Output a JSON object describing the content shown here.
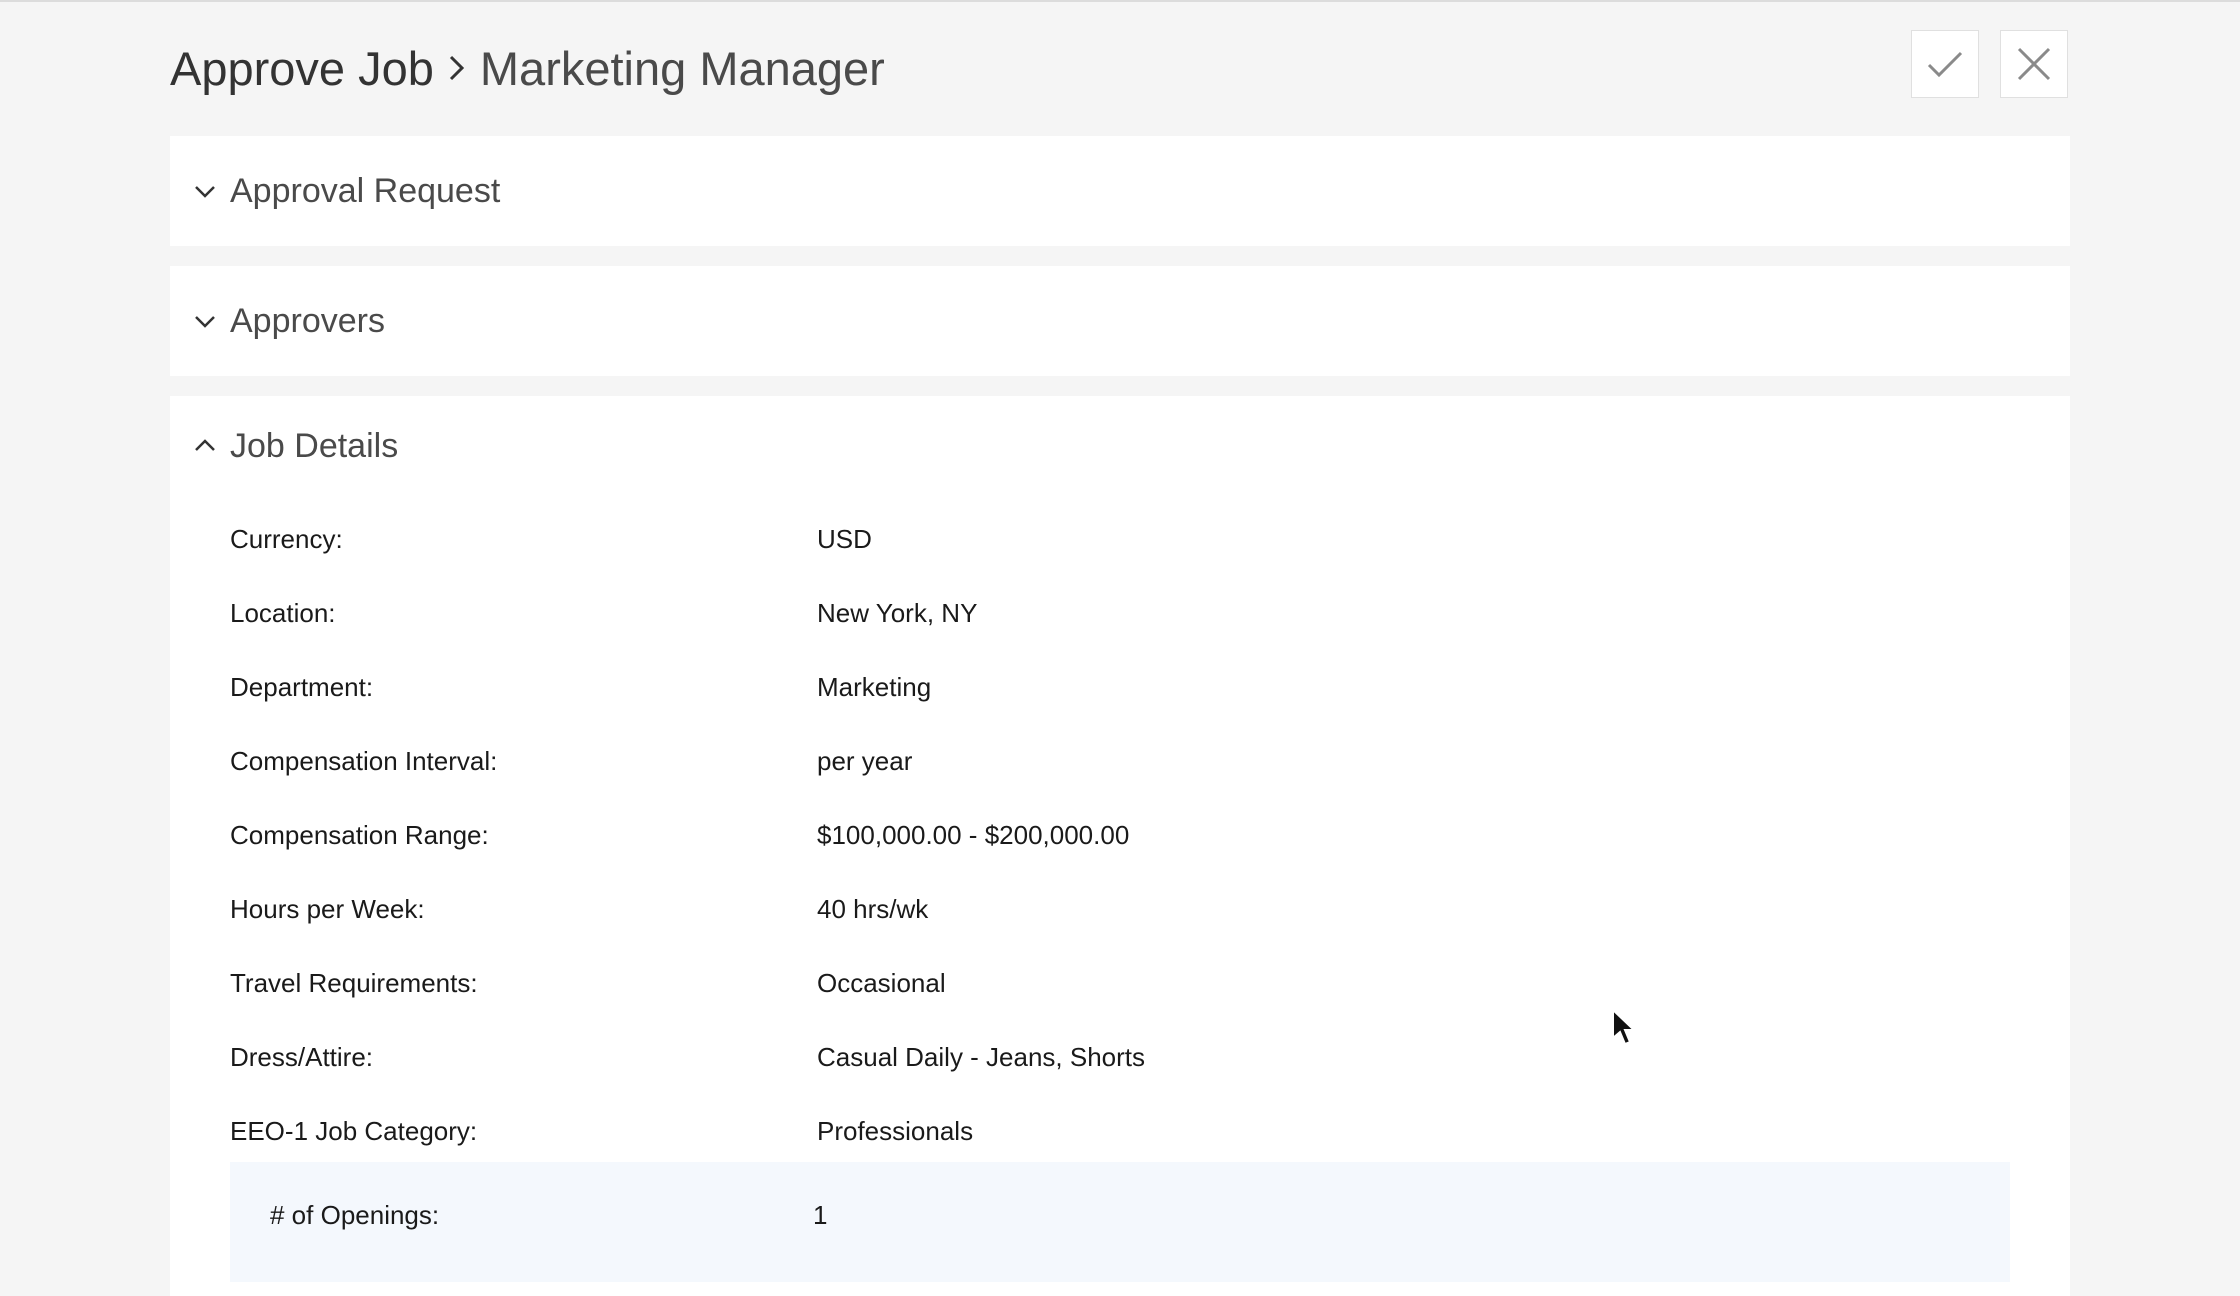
{
  "header": {
    "root": "Approve Job",
    "current": "Marketing Manager",
    "separator_icon": "chevron-right-icon"
  },
  "actions": {
    "approve_icon": "checkmark-icon",
    "reject_icon": "close-icon"
  },
  "sections": [
    {
      "title": "Approval Request",
      "expanded": false
    },
    {
      "title": "Approvers",
      "expanded": false
    },
    {
      "title": "Job Details",
      "expanded": true
    }
  ],
  "job_details": {
    "rows": [
      {
        "label": "Currency:",
        "value": "USD"
      },
      {
        "label": "Location:",
        "value": "New York, NY"
      },
      {
        "label": "Department:",
        "value": "Marketing"
      },
      {
        "label": "Compensation Interval:",
        "value": "per year"
      },
      {
        "label": "Compensation Range:",
        "value": "$100,000.00 - $200,000.00"
      },
      {
        "label": "Hours per Week:",
        "value": "40 hrs/wk"
      },
      {
        "label": "Travel Requirements:",
        "value": "Occasional"
      },
      {
        "label": "Dress/Attire:",
        "value": "Casual Daily - Jeans, Shorts"
      },
      {
        "label": "EEO-1 Job Category:",
        "value": "Professionals"
      }
    ],
    "openings": {
      "label": "# of Openings:",
      "value": "1"
    }
  },
  "colors": {
    "background": "#f5f5f5",
    "panel": "#ffffff",
    "highlight_row": "#f4f8fd",
    "icon": "#8a8a8a"
  }
}
